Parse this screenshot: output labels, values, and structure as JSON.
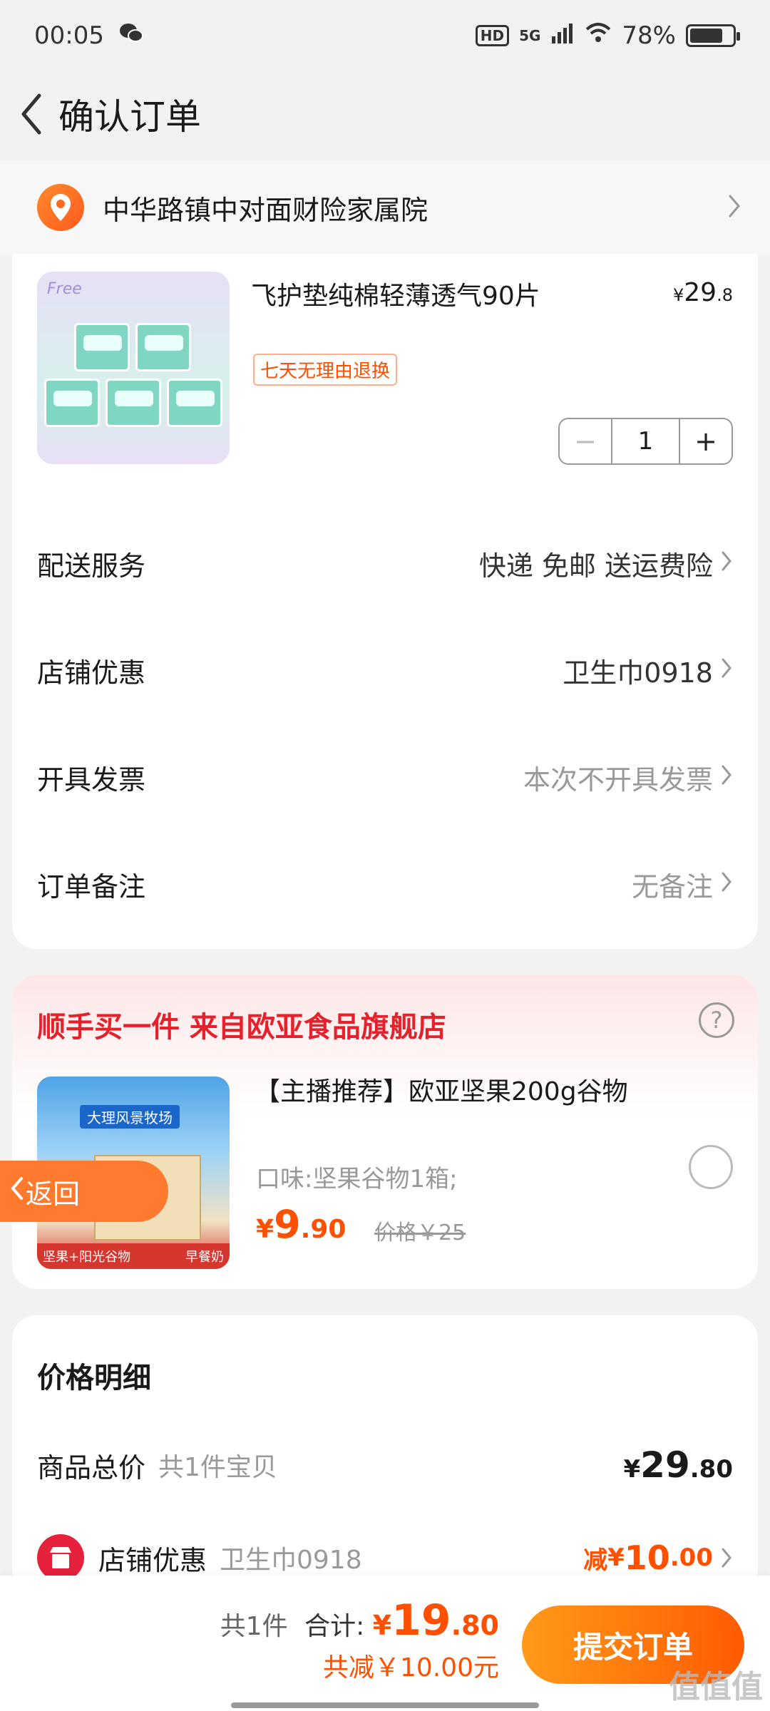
{
  "status_bar": {
    "time": "00:05",
    "hd": "HD",
    "network": "5G",
    "battery": "78%",
    "battery_level": 0.78
  },
  "nav": {
    "title": "确认订单"
  },
  "address": {
    "text": "中华路镇中对面财险家属院"
  },
  "product": {
    "brand": "Free",
    "name": "飞护垫纯棉轻薄透气90片",
    "price_currency": "¥",
    "price_int": "29",
    "price_dec": ".8",
    "tag": "七天无理由退换",
    "quantity": "1",
    "minus": "−",
    "plus": "+"
  },
  "rows": {
    "delivery_label": "配送服务",
    "delivery_value": "快递 免邮 送运费险",
    "shop_discount_label": "店铺优惠",
    "shop_discount_value": "卫生巾0918",
    "invoice_label": "开具发票",
    "invoice_value": "本次不开具发票",
    "note_label": "订单备注",
    "note_value": "无备注"
  },
  "recommend": {
    "title": "顺手买一件  来自欧亚食品旗舰店",
    "help": "?",
    "img_banner": "大理风景牧场",
    "img_foot_left": "坚果+阳光谷物",
    "img_foot_right": "早餐奶",
    "name": "【主播推荐】欧亚坚果200g谷物",
    "flavor": "口味:坚果谷物1箱;",
    "price_currency": "¥",
    "price_int": "9",
    "price_dec": ".90",
    "original": "价格￥25"
  },
  "back_button": {
    "label": "返回"
  },
  "price_detail": {
    "title": "价格明细",
    "total_label": "商品总价",
    "total_sub": "共1件宝贝",
    "total_currency": "¥",
    "total_int": "29",
    "total_dec": ".80",
    "shop_label": "店铺优惠",
    "shop_sub": "卫生巾0918",
    "shop_prefix": "减",
    "shop_currency": "¥",
    "shop_int": "10",
    "shop_dec": ".00"
  },
  "bottom": {
    "count": "共1件",
    "sum_label": "合计:",
    "sum_currency": "¥",
    "sum_int": "19",
    "sum_dec": ".80",
    "saved": "共减￥10.00元",
    "submit": "提交订单",
    "watermark": "值值值"
  },
  "colors": {
    "accent": "#ff5000",
    "red": "#e5212b"
  }
}
